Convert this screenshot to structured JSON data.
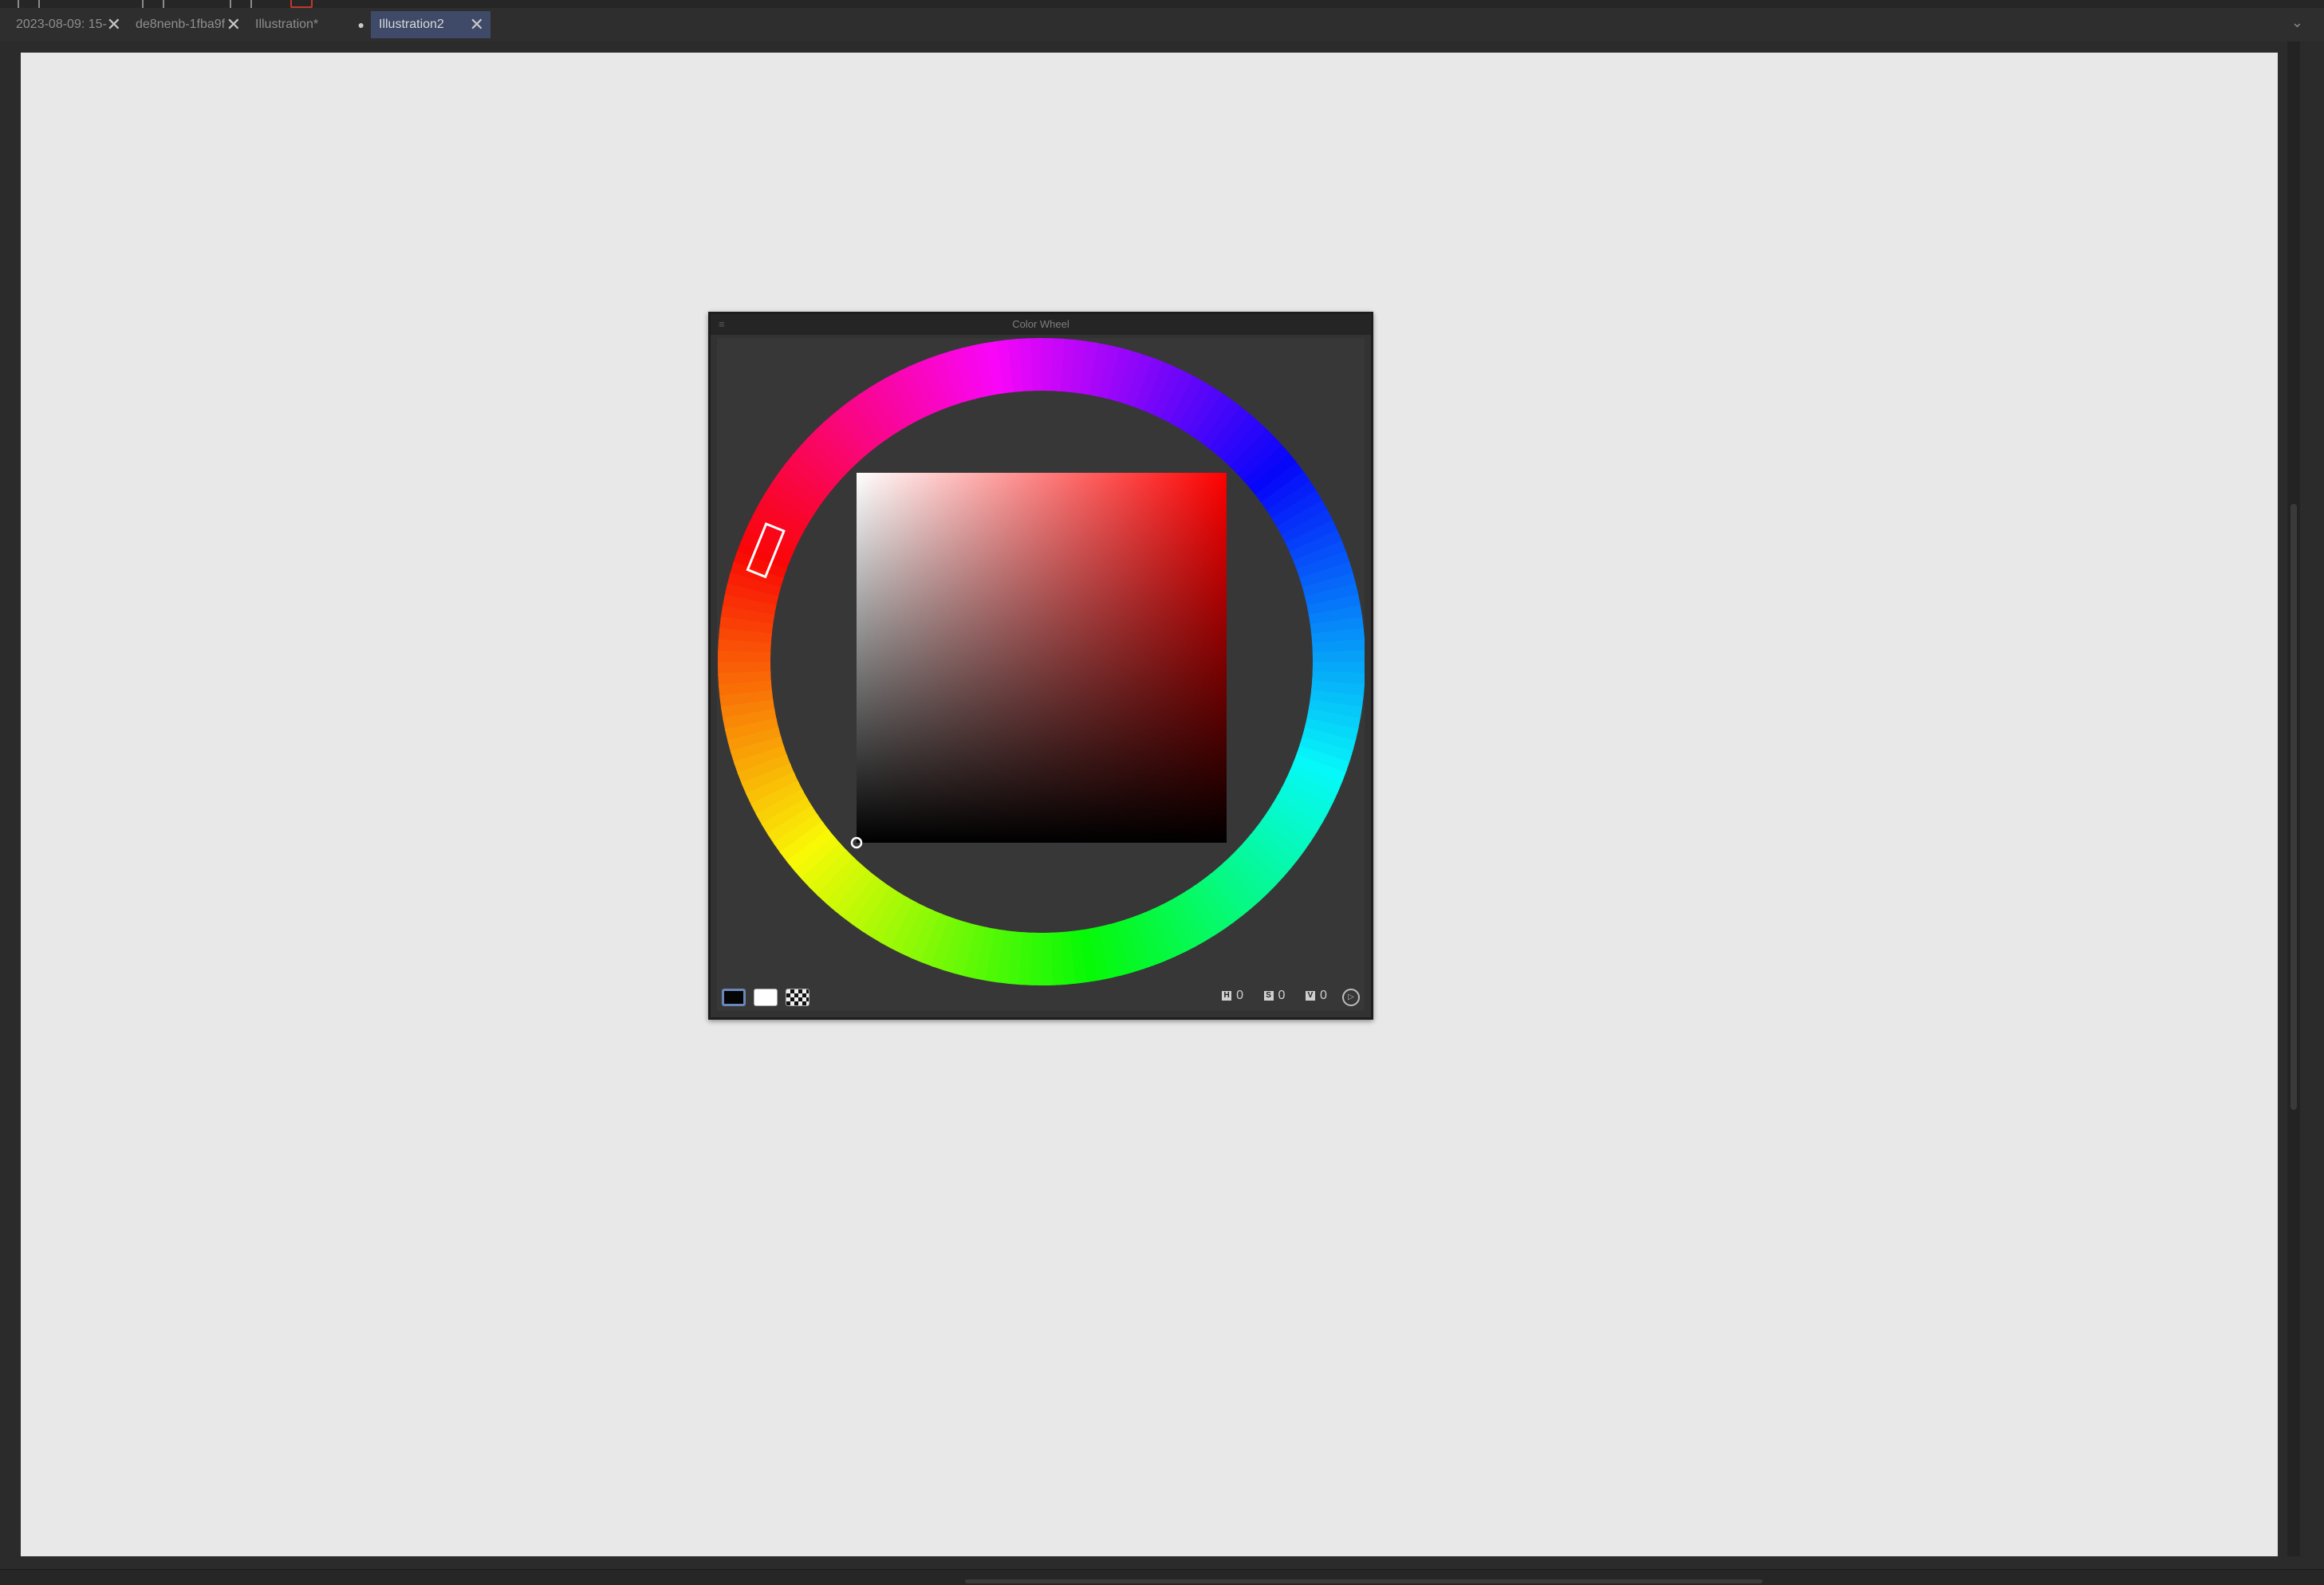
{
  "tabs": [
    {
      "label": "2023-08-09: 15-",
      "close_icon": "close-icon",
      "active": false
    },
    {
      "label": "de8nenb-1fba9f",
      "close_icon": "close-icon",
      "active": false
    },
    {
      "label": "Illustration*",
      "close_icon": "modified-dot",
      "active": false
    },
    {
      "label": "Illustration2",
      "close_icon": "close-icon",
      "active": true
    }
  ],
  "tab_close_glyph": "✕",
  "tab_modified_glyph": "●",
  "tabbar_chevron": "⌄",
  "docker": {
    "title": "Color Wheel",
    "menu_glyph": "≡",
    "selected_hue_deg": 0,
    "selector_saturation": 0,
    "selector_value": 0,
    "hsv": {
      "h_label": "H",
      "h_value": "0",
      "s_label": "S",
      "s_value": "0",
      "v_label": "V",
      "v_value": "0"
    },
    "foreground_color": "#000000",
    "background_color": "#ffffff",
    "settings_glyph": "▷"
  },
  "colors": {
    "canvas_bg": "#e8e8e8",
    "app_bg": "#2b2b2b",
    "active_tab": "#3e4a68",
    "docker_bg": "#373737"
  }
}
